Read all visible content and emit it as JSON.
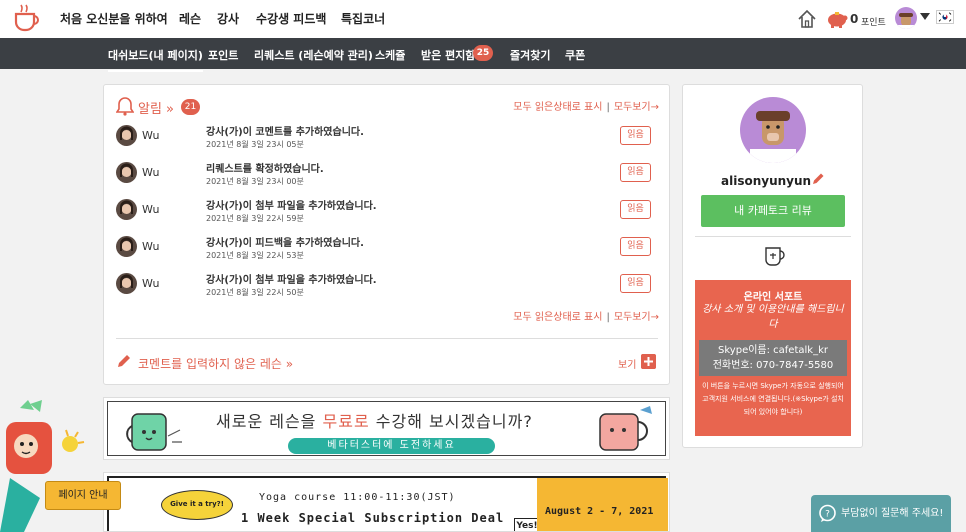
{
  "nav": {
    "items": [
      "처음 오신분을 위하여",
      "레슨",
      "강사",
      "수강생 피드백",
      "특집코너"
    ],
    "points_value": "0",
    "points_label": "포인트"
  },
  "subnav": {
    "items": [
      "대쉬보드(내 페이지)",
      "포인트",
      "리퀘스트 (레슨예약 관리)",
      "스케쥴",
      "받은 편지함",
      "즐겨찾기",
      "쿠폰"
    ],
    "mail_count": "25"
  },
  "notifications": {
    "title": "알림 »",
    "count": "21",
    "mark_all_read": "모두 읽은상태로 표시",
    "view_all": "모두보기→",
    "read_label": "읽음",
    "items": [
      {
        "user": "Wu",
        "message": "강사(가)이 코멘트를 추가하였습니다.",
        "time": "2021년 8월 3일 23시 05분"
      },
      {
        "user": "Wu",
        "message": "리퀘스트를 확정하였습니다.",
        "time": "2021년 8월 3일 23시 00분"
      },
      {
        "user": "Wu",
        "message": "강사(가)이 첨부 파일을 추가하였습니다.",
        "time": "2021년 8월 3일 22시 59분"
      },
      {
        "user": "Wu",
        "message": "강사(가)이 피드백을 추가하였습니다.",
        "time": "2021년 8월 3일 22시 53분"
      },
      {
        "user": "Wu",
        "message": "강사(가)이 첨부 파일을 추가하였습니다.",
        "time": "2021년 8월 3일 22시 50분"
      }
    ],
    "no_comment_title": "코멘트를 입력하지 않은 레슨 »",
    "view_label": "보기"
  },
  "banner1": {
    "title_pre": "새로운 레슨을 ",
    "title_highlight": "무료로",
    "title_post": " 수강해 보시겠습니까?",
    "cta": "베타터스터에 도전하세요"
  },
  "banner2": {
    "schedule": "Yoga course 11:00-11:30(JST)",
    "headline": "1 Week Special Subscription Deal",
    "dates": "August 2 - 7, 2021",
    "give_try": "Give it a try?!",
    "yes": "Yes!"
  },
  "profile": {
    "username": "alisonyunyun",
    "review_button": "내 카페토크 리뷰",
    "support_title": "온라인 서포트",
    "support_subtitle": "강사 소개 및 이용안내를 해드립니다",
    "skype": "Skype이름: cafetalk_kr",
    "phone": "전화번호: 070-7847-5580",
    "support_note": "이 버튼을 누르시면 Skype가 자동으로 실행되어 고객지원 서비스에 연결됩니다.(※Skype가 설치되어 있어야 합니다)"
  },
  "widgets": {
    "page_guide": "페이지 안내",
    "ask": "부담없이 질문해 주세요!"
  },
  "colors": {
    "accent": "#e0604e",
    "subnav_bg": "#3b3f44",
    "review_button": "#5cbf60",
    "ask_button": "#5ba0a5"
  }
}
